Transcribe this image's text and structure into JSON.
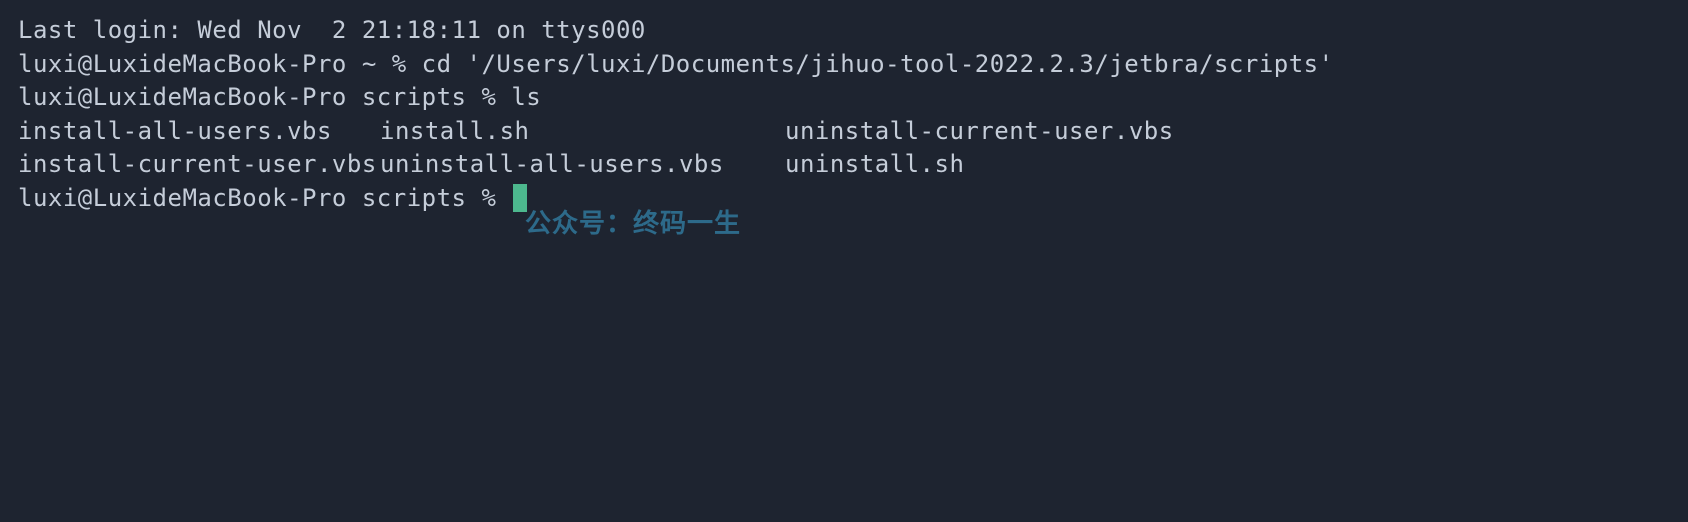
{
  "session": {
    "last_login": "Last login: Wed Nov  2 21:18:11 on ttys000"
  },
  "prompts": {
    "line1": {
      "user_host": "luxi@LuxideMacBook-Pro",
      "path": "~",
      "symbol": "%",
      "command": "cd '/Users/luxi/Documents/jihuo-tool-2022.2.3/jetbra/scripts'"
    },
    "line2": {
      "user_host": "luxi@LuxideMacBook-Pro",
      "path": "scripts",
      "symbol": "%",
      "command": "ls"
    },
    "line3": {
      "user_host": "luxi@LuxideMacBook-Pro",
      "path": "scripts",
      "symbol": "%"
    }
  },
  "ls_output": {
    "row1": {
      "col1": "install-all-users.vbs",
      "col2": "install.sh",
      "col3": "uninstall-current-user.vbs"
    },
    "row2": {
      "col1": "install-current-user.vbs",
      "col2": "uninstall-all-users.vbs",
      "col3": "uninstall.sh"
    }
  },
  "watermark": "公众号：终码一生"
}
